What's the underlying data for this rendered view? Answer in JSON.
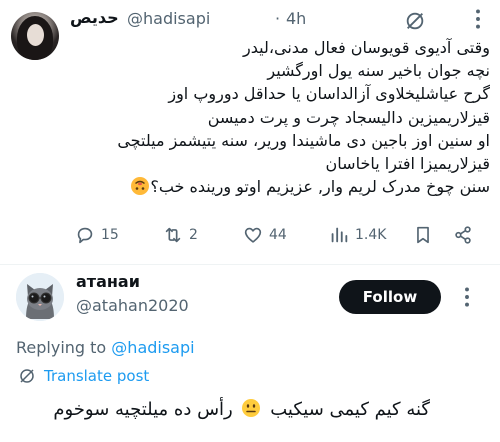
{
  "tweet": {
    "author_name": "حدیص",
    "handle": "@hadisapi",
    "separator": "·",
    "time": "4h",
    "icons": {
      "no_translate": "no-entry-slash-icon",
      "more": "more-vertical-icon"
    },
    "lines": [
      "وقتی آدیوی قویوسان فعال مدنی،لیدر",
      "نچه جوان باخیر سنه یول اورگشیر",
      "گرح عیاشلیخلاوی آزالداسان یا حداقل دوروپ اوز",
      "قیزلاریمیزین دالیسجاد چرت و پرت دمیسن",
      "او سنین اوز باجین دی ماشیندا وریر، سنه یتیشمز میلتچی",
      "قیزلاریمیزا افترا یاخاسان",
      "سنن چوخ مدرک لریم وار, عزیزیم اوتو ورینده خب؟"
    ],
    "trailing_emoji": "upside-down-face-emoji",
    "actions": {
      "replies": "15",
      "retweets": "2",
      "likes": "44",
      "views": "1.4K"
    }
  },
  "reply": {
    "author_name": "атанаи",
    "handle": "@atahan2020",
    "follow_label": "Follow",
    "replying_prefix": "Replying to",
    "replying_to": "@hadisapi",
    "translate_label": "Translate post",
    "text": "گنه کیم کیمی سیکیب",
    "text_after_emoji": "رأس ده میلتچیه سوخوم",
    "emoji": "neutral-face-emoji"
  },
  "colors": {
    "link": "#1d9bf0",
    "secondary": "#536471",
    "text": "#0f1419",
    "button": "#0f1419"
  }
}
